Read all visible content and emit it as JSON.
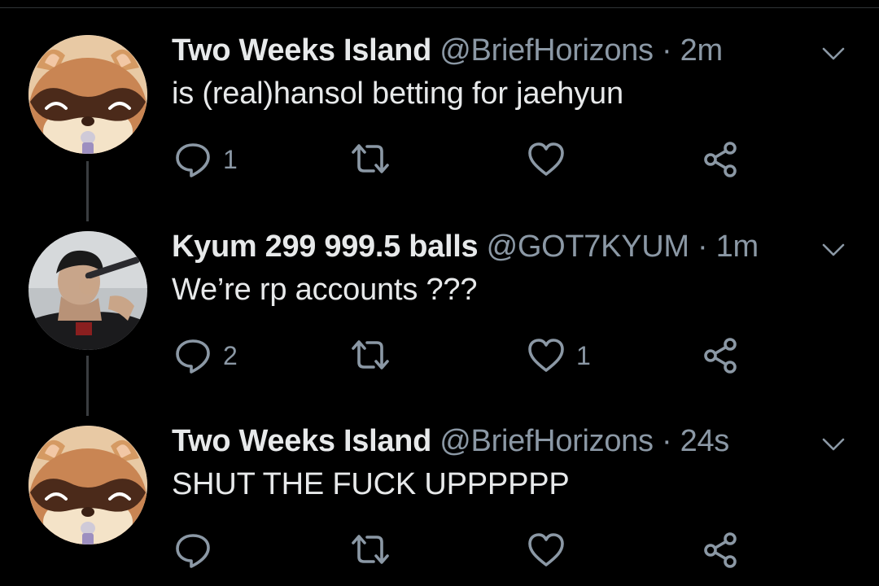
{
  "colors": {
    "background": "#000000",
    "primary_text": "#e7e9ea",
    "secondary_text": "#8b98a5",
    "thread_line": "#3a3d40"
  },
  "tweets": [
    {
      "name": "Two Weeks Island",
      "handle": "@BriefHorizons",
      "separator": "·",
      "time": "2m",
      "text": "is (real)hansol betting for jaehyun",
      "avatar": "tanuki-avatar",
      "reply_count": "1",
      "retweet_count": "",
      "like_count": ""
    },
    {
      "name": "Kyum 299 999.5 balls",
      "handle": "@GOT7KYUM",
      "separator": "·",
      "time": "1m",
      "text": "We’re rp accounts ???",
      "avatar": "singer-photo-avatar",
      "reply_count": "2",
      "retweet_count": "",
      "like_count": "1"
    },
    {
      "name": "Two Weeks Island",
      "handle": "@BriefHorizons",
      "separator": "·",
      "time": "24s",
      "text": "SHUT THE FUCK UPPPPPP",
      "avatar": "tanuki-avatar",
      "reply_count": "",
      "retweet_count": "",
      "like_count": ""
    }
  ],
  "icons": {
    "reply": "reply-icon",
    "retweet": "retweet-icon",
    "like": "heart-icon",
    "share": "share-icon",
    "menu": "chevron-down-icon"
  }
}
